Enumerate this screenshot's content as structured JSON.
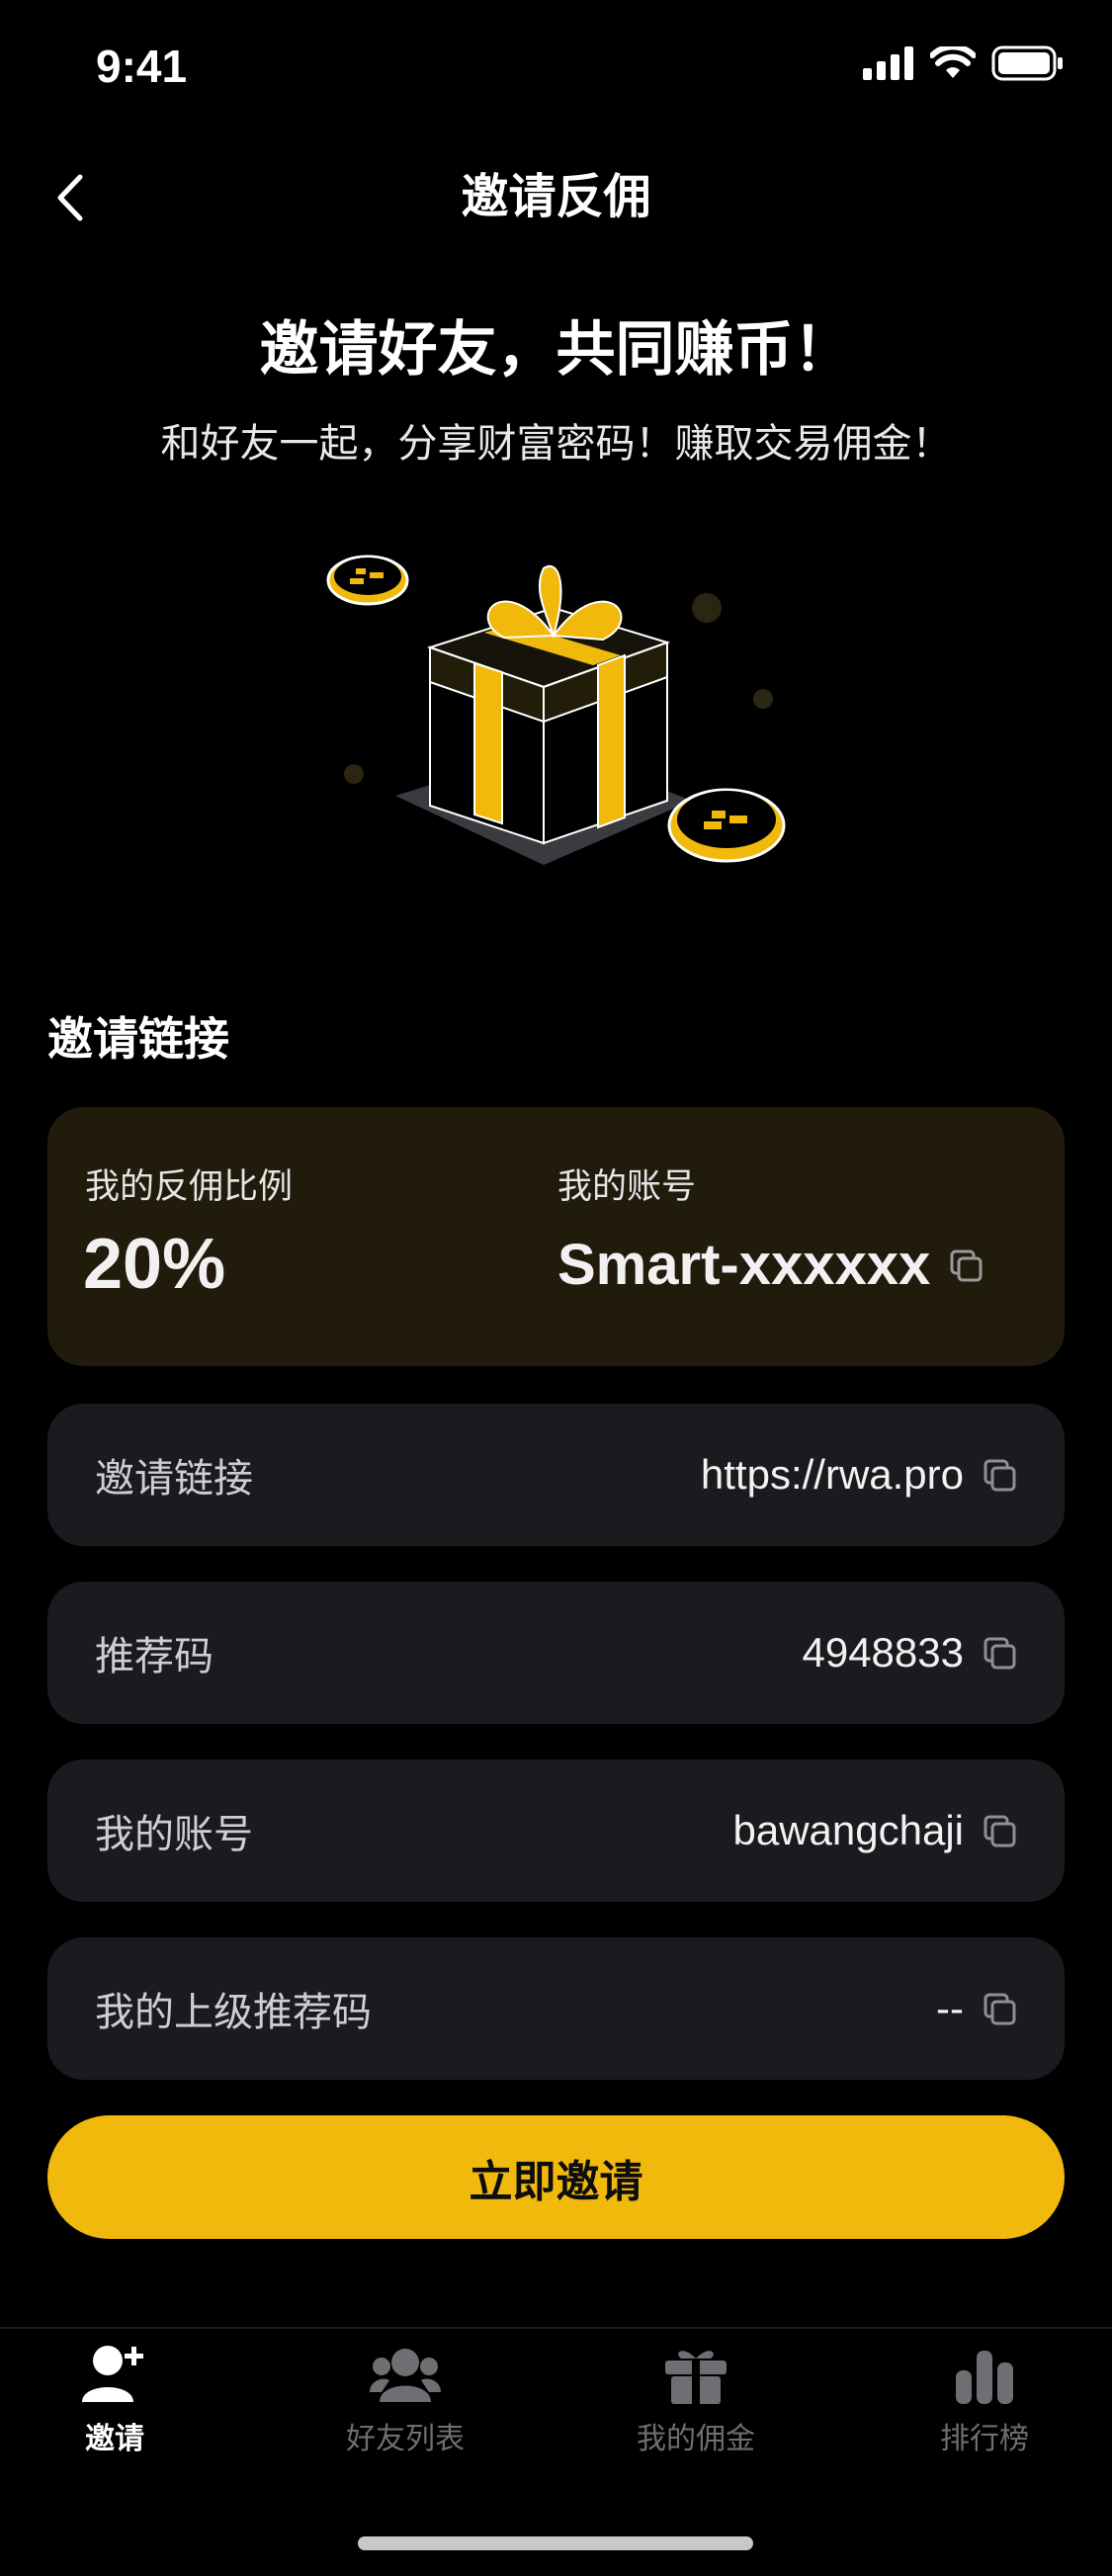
{
  "status": {
    "time": "9:41"
  },
  "nav": {
    "title": "邀请反佣"
  },
  "hero": {
    "headline": "邀请好友，共同赚币！",
    "subline": "和好友一起，分享财富密码！赚取交易佣金！"
  },
  "section": {
    "title": "邀请链接"
  },
  "summary": {
    "ratio_label": "我的反佣比例",
    "ratio_value": "20%",
    "account_label": "我的账号",
    "account_value": "Smart-xxxxxx"
  },
  "rows": [
    {
      "label": "邀请链接",
      "value": "https://rwa.pro"
    },
    {
      "label": "推荐码",
      "value": "4948833"
    },
    {
      "label": "我的账号",
      "value": "bawangchaji"
    },
    {
      "label": "我的上级推荐码",
      "value": "--"
    }
  ],
  "cta": {
    "label": "立即邀请"
  },
  "tabs": [
    {
      "label": "邀请",
      "icon": "user-plus-icon",
      "active": true
    },
    {
      "label": "好友列表",
      "icon": "friends-icon",
      "active": false
    },
    {
      "label": "我的佣金",
      "icon": "gift-icon",
      "active": false
    },
    {
      "label": "排行榜",
      "icon": "bar-chart-icon",
      "active": false
    }
  ],
  "colors": {
    "accent": "#F0B90B",
    "card_bg": "#1A1B1F",
    "summary_bg": "#211B0B",
    "background": "#000000"
  }
}
